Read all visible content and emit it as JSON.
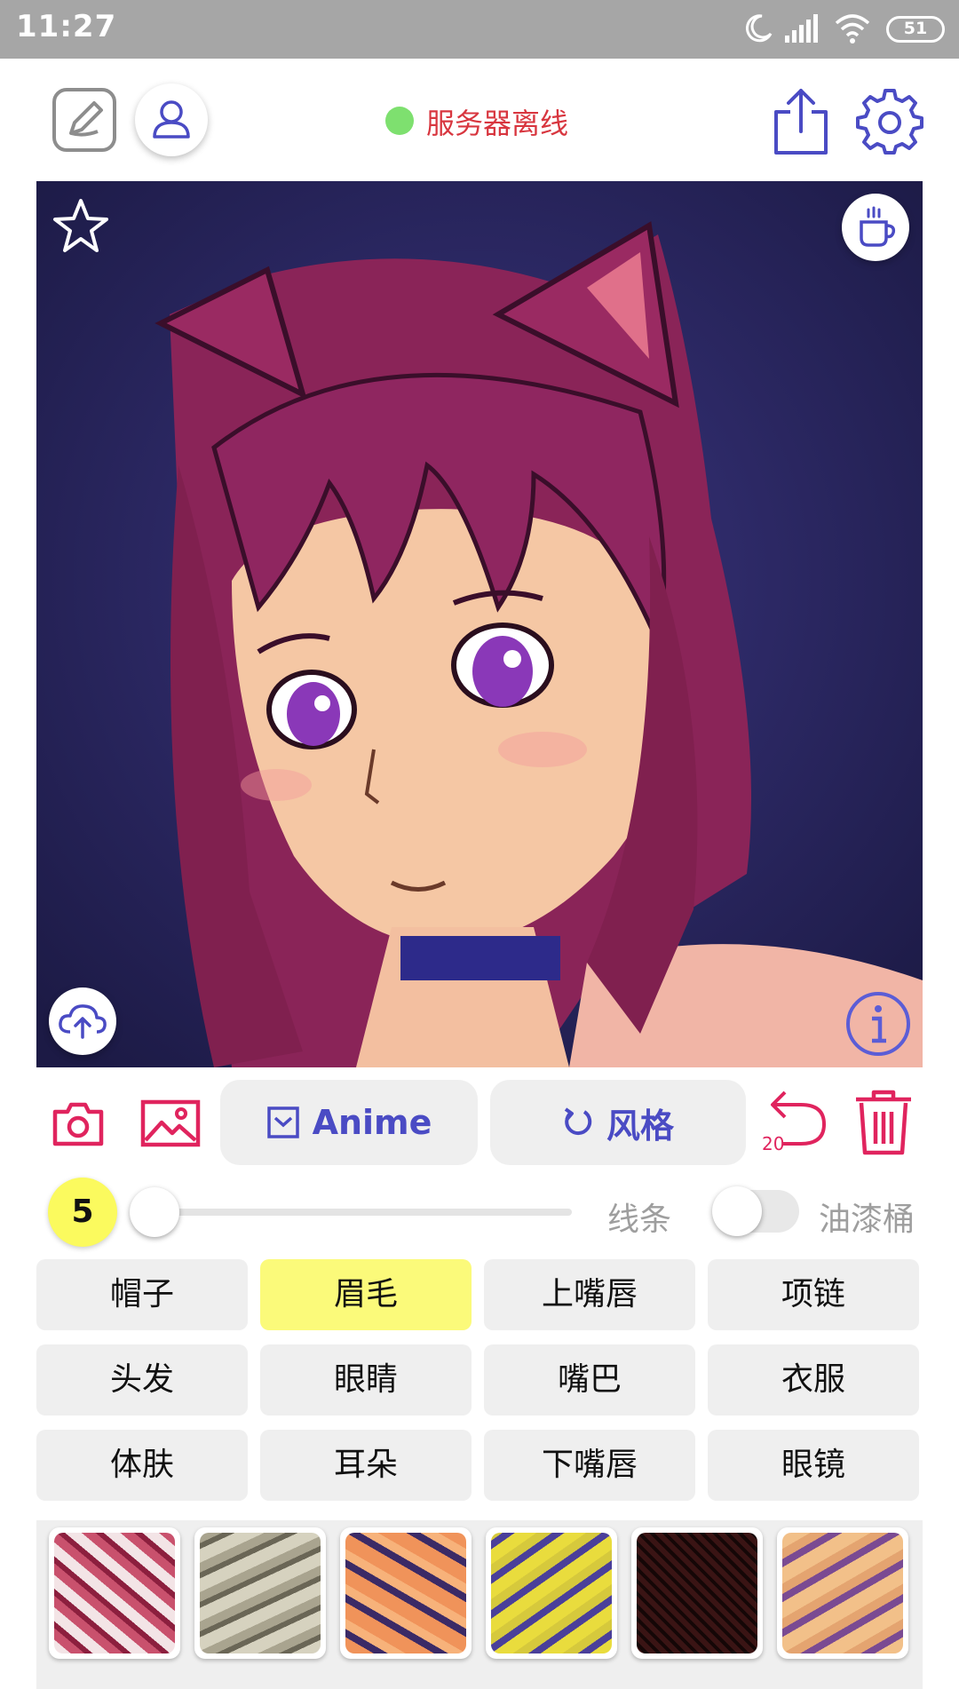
{
  "status_bar": {
    "time": "11:27",
    "battery": "51",
    "icons": [
      "moon-icon",
      "signal-icon",
      "wifi-icon",
      "battery-icon"
    ]
  },
  "toolbar": {
    "server_status": "服务器离线",
    "server_dot_color": "#7ee06f",
    "icons": [
      "sketch-icon",
      "user-icon",
      "share-icon",
      "settings-icon"
    ]
  },
  "canvas": {
    "overlay_icons": [
      "star-icon",
      "coffee-icon",
      "upload-cloud-icon",
      "info-icon"
    ]
  },
  "actions": {
    "model_label": "Anime",
    "style_label": "风格",
    "undo_count": "20",
    "icons": [
      "camera-icon",
      "gallery-icon",
      "checkbox-icon",
      "refresh-icon",
      "undo-icon",
      "trash-icon"
    ]
  },
  "brush": {
    "size": "5",
    "slider_fraction": 0.0,
    "lines_label": "线条",
    "bucket_label": "油漆桶",
    "bucket_enabled": false
  },
  "parts": [
    {
      "label": "帽子",
      "selected": false
    },
    {
      "label": "眉毛",
      "selected": true
    },
    {
      "label": "上嘴唇",
      "selected": false
    },
    {
      "label": "项链",
      "selected": false
    },
    {
      "label": "头发",
      "selected": false
    },
    {
      "label": "眼睛",
      "selected": false
    },
    {
      "label": "嘴巴",
      "selected": false
    },
    {
      "label": "衣服",
      "selected": false
    },
    {
      "label": "体肤",
      "selected": false
    },
    {
      "label": "耳朵",
      "selected": false
    },
    {
      "label": "下嘴唇",
      "selected": false
    },
    {
      "label": "眼镜",
      "selected": false
    }
  ],
  "textures": [
    {
      "name": "texture-red-white",
      "color": "#c9516d"
    },
    {
      "name": "texture-grey",
      "color": "#a9a48f"
    },
    {
      "name": "texture-orange",
      "color": "#f0935a"
    },
    {
      "name": "texture-yellow-blue",
      "color": "#d6c93c"
    },
    {
      "name": "texture-dark-red",
      "color": "#3a1414"
    },
    {
      "name": "texture-peach-purple",
      "color": "#e4a470"
    }
  ],
  "colors": {
    "accent_blue": "#4a4bc4",
    "accent_red": "#e0245e",
    "highlight_yellow": "#fbfa7a"
  }
}
